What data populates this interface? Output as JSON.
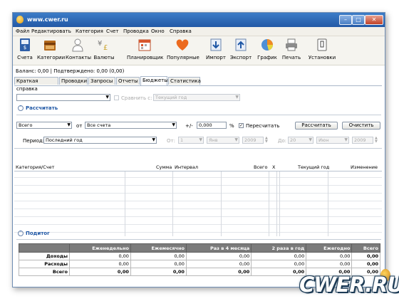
{
  "window": {
    "title": "www.cwer.ru"
  },
  "menu": [
    "Файл",
    "Редактировать",
    "Категория",
    "Счет",
    "Проводка",
    "Окно",
    "Справка"
  ],
  "toolbar": [
    {
      "label": "Счета",
      "icon": "ledger-icon"
    },
    {
      "label": "Категории",
      "icon": "folder-icon"
    },
    {
      "label": "Контакты",
      "icon": "person-icon"
    },
    {
      "label": "Валюты",
      "icon": "currency-icon"
    },
    {
      "label": "Планировщик",
      "icon": "calendar-icon"
    },
    {
      "label": "Популярные",
      "icon": "heart-icon"
    },
    {
      "label": "Импорт",
      "icon": "import-icon"
    },
    {
      "label": "Экспорт",
      "icon": "export-icon"
    },
    {
      "label": "График",
      "icon": "pie-chart-icon"
    },
    {
      "label": "Печать",
      "icon": "printer-icon"
    },
    {
      "label": "Установки",
      "icon": "settings-icon"
    }
  ],
  "status": "Баланс: 0,00 | Подтверждено: 0,00 (0,00)",
  "tabs": [
    "Краткая справка",
    "Проводки",
    "Запросы",
    "Отчеты",
    "Бюджеты",
    "Статистика"
  ],
  "active_tab": "Бюджеты",
  "filter": {
    "compare_label": "Сравнить с:",
    "compare_value": "Текущий год"
  },
  "calc_section": "Рассчитать",
  "calc": {
    "type_value": "Всего",
    "from_label": "от",
    "account_value": "Все счета",
    "plusminus": "+/-",
    "amount": "0,000",
    "percent": "%",
    "recalc_label": "Пересчитать",
    "calc_button": "Рассчитать",
    "clear_button": "Очистить",
    "period_label": "Период:",
    "period_value": "Последний год",
    "from_date_label": "От:",
    "from_day": "1",
    "from_month": "Янв",
    "from_year": "2009",
    "to_date_label": "До:",
    "to_day": "20",
    "to_month": "Июн",
    "to_year": "2009"
  },
  "grid_headers": [
    "Категория/Счет",
    "Сумма",
    "Интервал",
    "Всего",
    "X",
    "Текущий год",
    "Изменение"
  ],
  "summary_section": "Подитог",
  "summary": {
    "columns": [
      "",
      "Еженедельно",
      "Ежемесячно",
      "Раз в 4 месяца",
      "2 раза в год",
      "Ежегодно",
      "Всего"
    ],
    "rows": [
      {
        "label": "Доходы",
        "values": [
          "0,00",
          "0,00",
          "0,00",
          "0,00",
          "0,00",
          "0,00"
        ]
      },
      {
        "label": "Расходы",
        "values": [
          "0,00",
          "0,00",
          "0,00",
          "0,00",
          "0,00",
          "0,00"
        ]
      },
      {
        "label": "Всего",
        "values": [
          "0,00",
          "0,00",
          "0,00",
          "0,00",
          "0,00",
          "0,00"
        ]
      }
    ]
  },
  "watermark": "CWER.RU"
}
